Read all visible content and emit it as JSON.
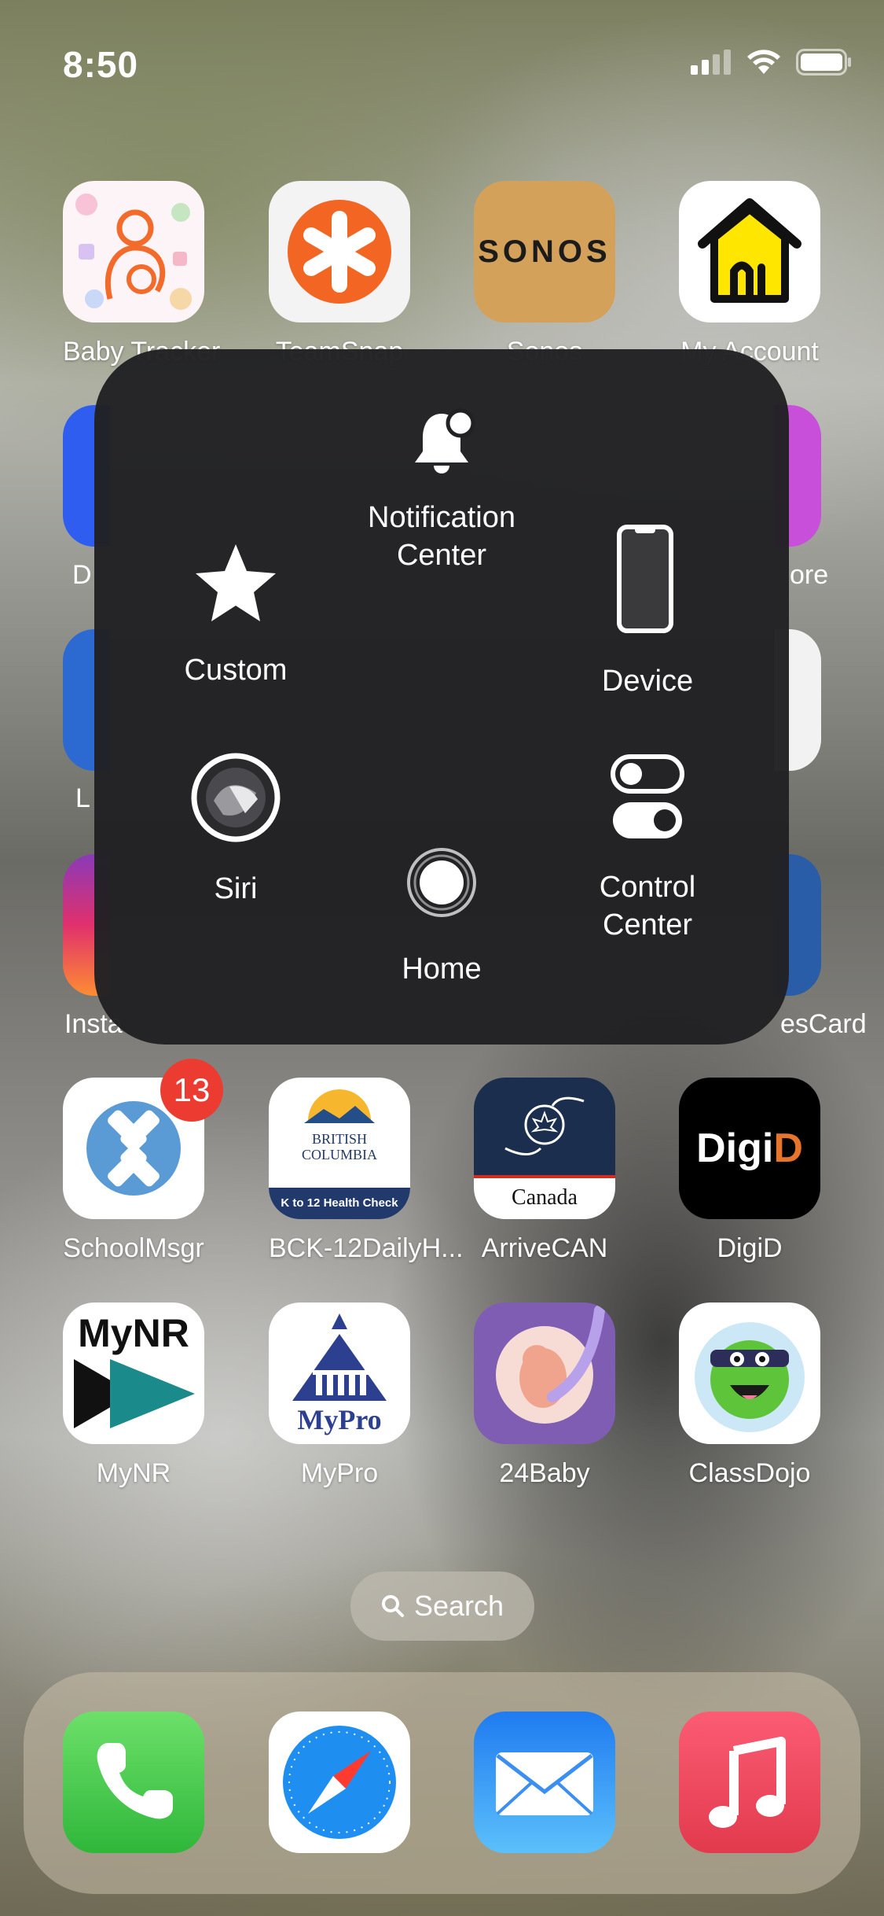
{
  "status_bar": {
    "time": "8:50"
  },
  "apps_row1": [
    {
      "label": "Baby Tracker"
    },
    {
      "label": "TeamSnap"
    },
    {
      "label": "Sonos",
      "logo": "SONOS"
    },
    {
      "label": "My Account"
    }
  ],
  "apps_partial": {
    "row2_left": "D",
    "row2_right": "ore",
    "row3_left": "L",
    "row4_left": "Insta",
    "row4_right": "esCard"
  },
  "apps_row5": [
    {
      "label": "SchoolMsgr",
      "badge": "13"
    },
    {
      "label": "BCK-12DailyH...",
      "logo_line1": "BRITISH",
      "logo_line2": "COLUMBIA",
      "logo_bar": "K to 12 Health Check"
    },
    {
      "label": "ArriveCAN",
      "logo": "Canada"
    },
    {
      "label": "DigiD",
      "logo_a": "Digi",
      "logo_b": "D"
    }
  ],
  "apps_row6": [
    {
      "label": "MyNR",
      "logo": "MyNR"
    },
    {
      "label": "MyPro",
      "logo": "MyPro"
    },
    {
      "label": "24Baby"
    },
    {
      "label": "ClassDojo"
    }
  ],
  "assistive_touch": {
    "notification_center": "Notification\nCenter",
    "custom": "Custom",
    "device": "Device",
    "siri": "Siri",
    "control_center": "Control\nCenter",
    "home": "Home"
  },
  "search": {
    "label": "Search"
  },
  "dock": [
    "Phone",
    "Safari",
    "Mail",
    "Music"
  ],
  "colors": {
    "panel": "#212124",
    "badge": "#ec3c32",
    "teamsnap": "#f26522",
    "sonos": "#d4a15a",
    "digid_accent": "#e8742b"
  }
}
